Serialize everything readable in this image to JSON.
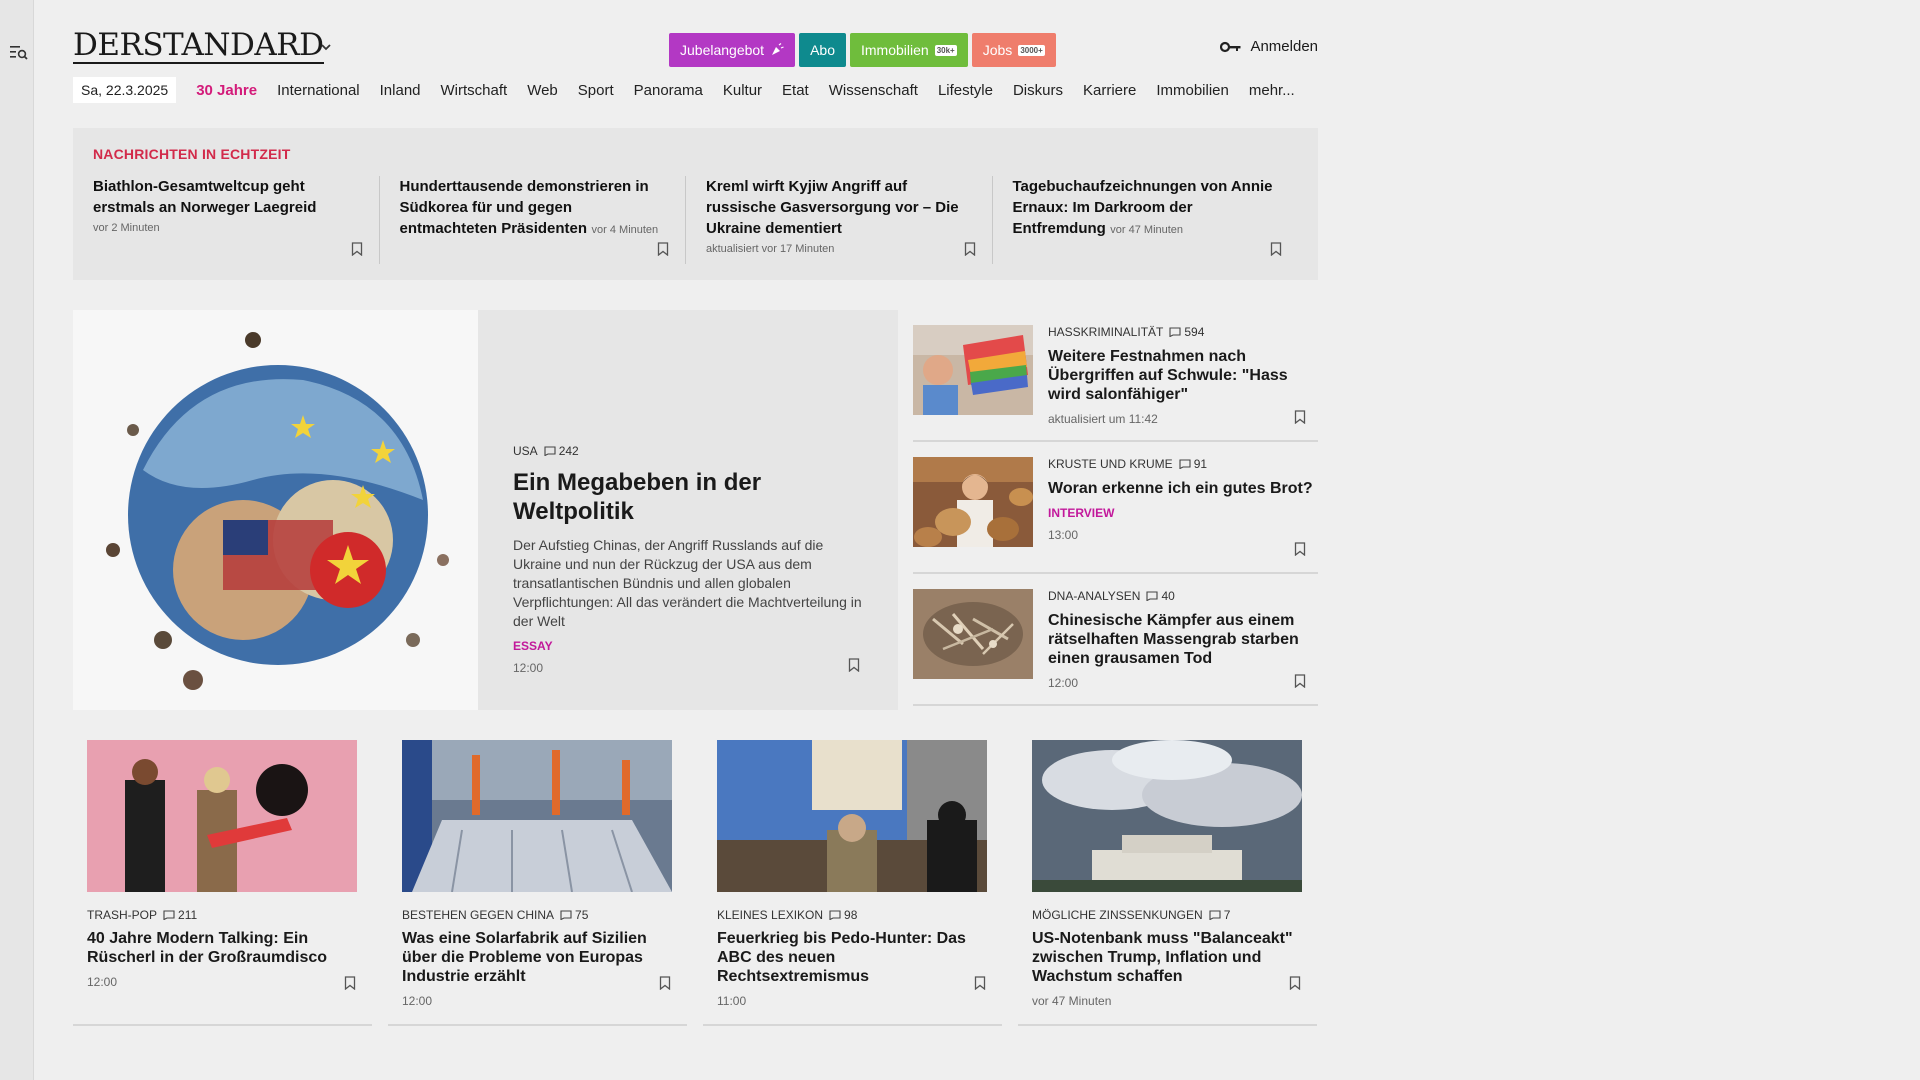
{
  "header": {
    "logo": "DERSTANDARD",
    "buttons": {
      "jubel": "Jubelangebot",
      "abo": "Abo",
      "immo": "Immobilien",
      "immo_tag": "30k+",
      "jobs": "Jobs",
      "jobs_tag": "3000+"
    },
    "login": "Anmelden"
  },
  "nav": {
    "date": "Sa, 22.3.2025",
    "items": [
      "30 Jahre",
      "International",
      "Inland",
      "Wirtschaft",
      "Web",
      "Sport",
      "Panorama",
      "Kultur",
      "Etat",
      "Wissenschaft",
      "Lifestyle",
      "Diskurs",
      "Karriere",
      "Immobilien",
      "mehr..."
    ]
  },
  "ticker": {
    "heading": "NACHRICHTEN IN ECHTZEIT",
    "items": [
      {
        "title": "Biathlon-Gesamtweltcup geht erstmals an Norweger Laegreid",
        "meta": "vor 2 Minuten"
      },
      {
        "title": "Hunderttausende demonstrieren in Südkorea für und gegen entmachteten Präsidenten",
        "meta": "vor 4 Minuten"
      },
      {
        "title": "Kreml wirft Kyjiw Angriff auf russische Gasversorgung vor – Die Ukraine dementiert",
        "meta": "aktualisiert vor 17 Minuten"
      },
      {
        "title": "Tagebuchaufzeichnungen von Annie Ernaux: Im Darkroom der Entfremdung",
        "meta": "vor 47 Minuten"
      }
    ]
  },
  "lead": {
    "kicker": "USA",
    "comments": "242",
    "title": "Ein Megabeben in der Weltpolitik",
    "teaser": "Der Aufstieg Chinas, der Angriff Russlands auf die Ukraine und nun der Rückzug der USA aus dem transatlantischen Bündnis und allen globalen Verpflichtungen: All das verändert die Machtverteilung in der Welt",
    "label": "ESSAY",
    "time": "12:00"
  },
  "side": [
    {
      "kicker": "HASSKRIMINALITÄT",
      "comments": "594",
      "title": "Weitere Festnahmen nach Übergriffen auf Schwule: \"Hass wird salonfähiger\"",
      "label": "",
      "time": "aktualisiert um 11:42"
    },
    {
      "kicker": "KRUSTE UND KRUME",
      "comments": "91",
      "title": "Woran erkenne ich ein gutes Brot?",
      "label": "INTERVIEW",
      "time": "13:00"
    },
    {
      "kicker": "DNA-ANALYSEN",
      "comments": "40",
      "title": "Chinesische Kämpfer aus einem rätselhaften Massengrab starben einen grausamen Tod",
      "label": "",
      "time": "12:00"
    }
  ],
  "grid": [
    {
      "kicker": "TRASH-POP",
      "comments": "211",
      "title": "40 Jahre Modern Talking: Ein Rüscherl in der Großraumdisco",
      "time": "12:00"
    },
    {
      "kicker": "BESTEHEN GEGEN CHINA",
      "comments": "75",
      "title": "Was eine Solarfabrik auf Sizilien über die Probleme von Europas Industrie erzählt",
      "time": "12:00"
    },
    {
      "kicker": "KLEINES LEXIKON",
      "comments": "98",
      "title": "Feuerkrieg bis Pedo-Hunter: Das ABC des neuen Rechtsextremismus",
      "time": "11:00"
    },
    {
      "kicker": "MÖGLICHE ZINSSENKUNGEN",
      "comments": "7",
      "title": "US-Notenbank muss \"Balanceakt\" zwischen Trump, Inflation und Wachstum schaffen",
      "time": "vor 47 Minuten"
    }
  ],
  "colors": {
    "accent_magenta": "#d31b7a",
    "ticker_red": "#d22a4a",
    "jubel": "#b338c4",
    "abo": "#0e8a8e",
    "immo": "#6fbd3c",
    "jobs": "#ef7d6c"
  }
}
